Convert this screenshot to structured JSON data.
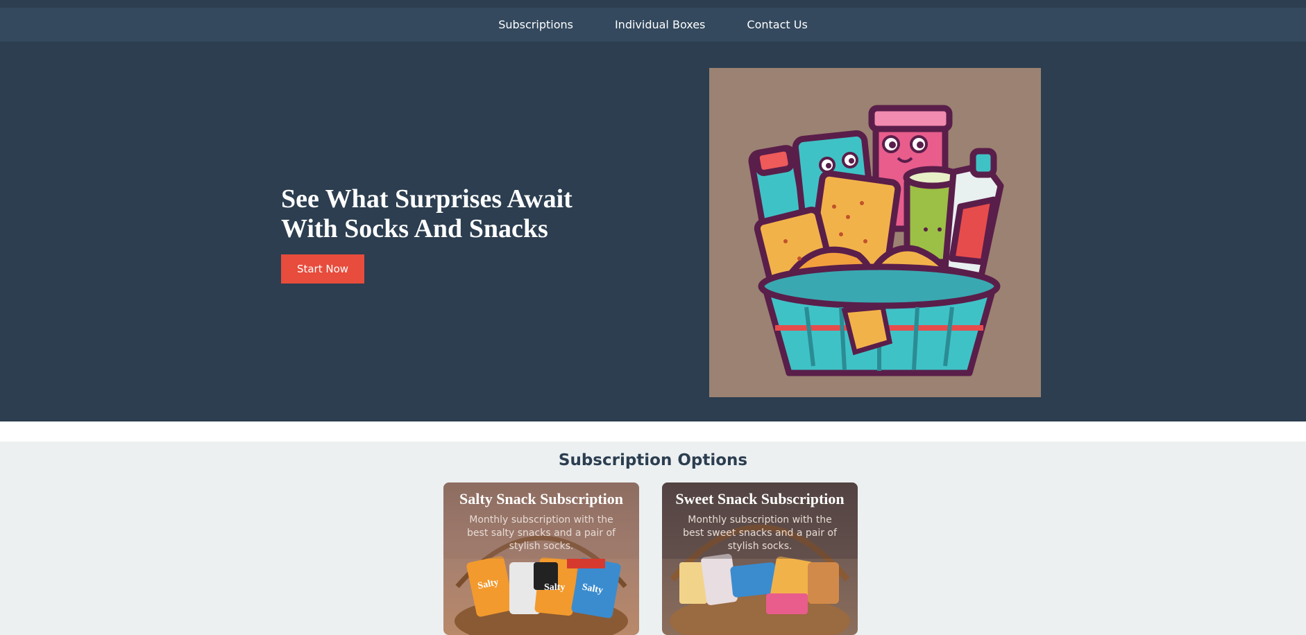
{
  "nav": {
    "items": [
      {
        "label": "Subscriptions"
      },
      {
        "label": "Individual Boxes"
      },
      {
        "label": "Contact Us"
      }
    ]
  },
  "hero": {
    "title": "See What Surprises Await With Socks And Snacks",
    "cta_label": "Start Now",
    "image_icon": "snack-basket-illustration"
  },
  "subscriptions": {
    "title": "Subscription Options",
    "cards": [
      {
        "title": "Salty Snack Subscription",
        "description": "Monthly subscription with the best salty snacks and a pair of stylish socks.",
        "image_icon": "salty-snack-basket-photo"
      },
      {
        "title": "Sweet Snack Subscription",
        "description": "Monthly subscription with the best sweet snacks and a pair of stylish socks.",
        "image_icon": "sweet-snack-basket-photo"
      }
    ]
  },
  "colors": {
    "header_bg": "#2c3e50",
    "nav_bg": "#34495e",
    "accent": "#e74c3c",
    "section_bg": "#ecf0f1"
  }
}
